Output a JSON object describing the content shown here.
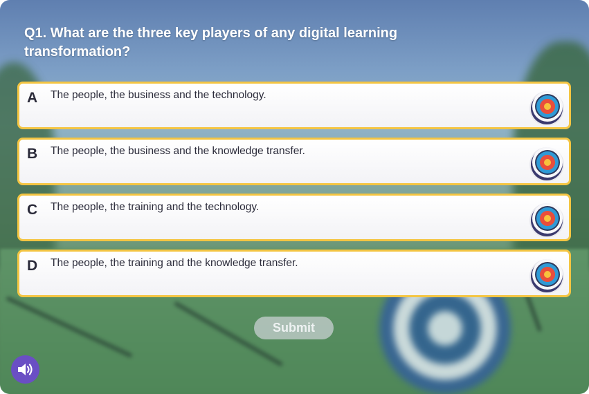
{
  "question": {
    "text": "Q1. What are the three key players of any digital learning transformation?"
  },
  "answers": [
    {
      "letter": "A",
      "text": "The people, the business and the technology."
    },
    {
      "letter": "B",
      "text": "The people, the business and the knowledge transfer."
    },
    {
      "letter": "C",
      "text": "The people, the training and the technology."
    },
    {
      "letter": "D",
      "text": "The people, the training and the knowledge transfer."
    }
  ],
  "submit": {
    "label": "Submit",
    "state": "disabled"
  },
  "icons": {
    "answer_icon": "archery-target-icon",
    "audio_icon": "speaker-icon"
  },
  "colors": {
    "answer_border": "#f4c542",
    "audio_button": "#6a4fc4",
    "question_text": "#ffffff"
  }
}
